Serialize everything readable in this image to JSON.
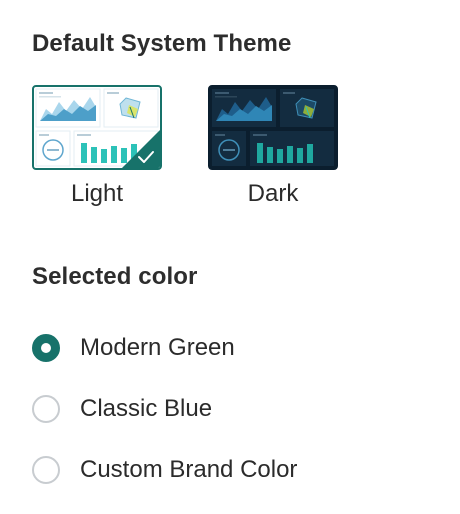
{
  "theme_section": {
    "title": "Default System Theme",
    "options": [
      {
        "label": "Light",
        "selected": true
      },
      {
        "label": "Dark",
        "selected": false
      }
    ]
  },
  "color_section": {
    "title": "Selected color",
    "options": [
      {
        "label": "Modern Green",
        "selected": true
      },
      {
        "label": "Classic Blue",
        "selected": false
      },
      {
        "label": "Custom Brand Color",
        "selected": false
      }
    ]
  },
  "colors": {
    "accent": "#17726a",
    "radio_border": "#c8ccd0",
    "dark_theme_bg": "#0b1e2e",
    "text": "#2b2b2b"
  },
  "icons": {
    "selected_check": "checkmark-icon"
  }
}
